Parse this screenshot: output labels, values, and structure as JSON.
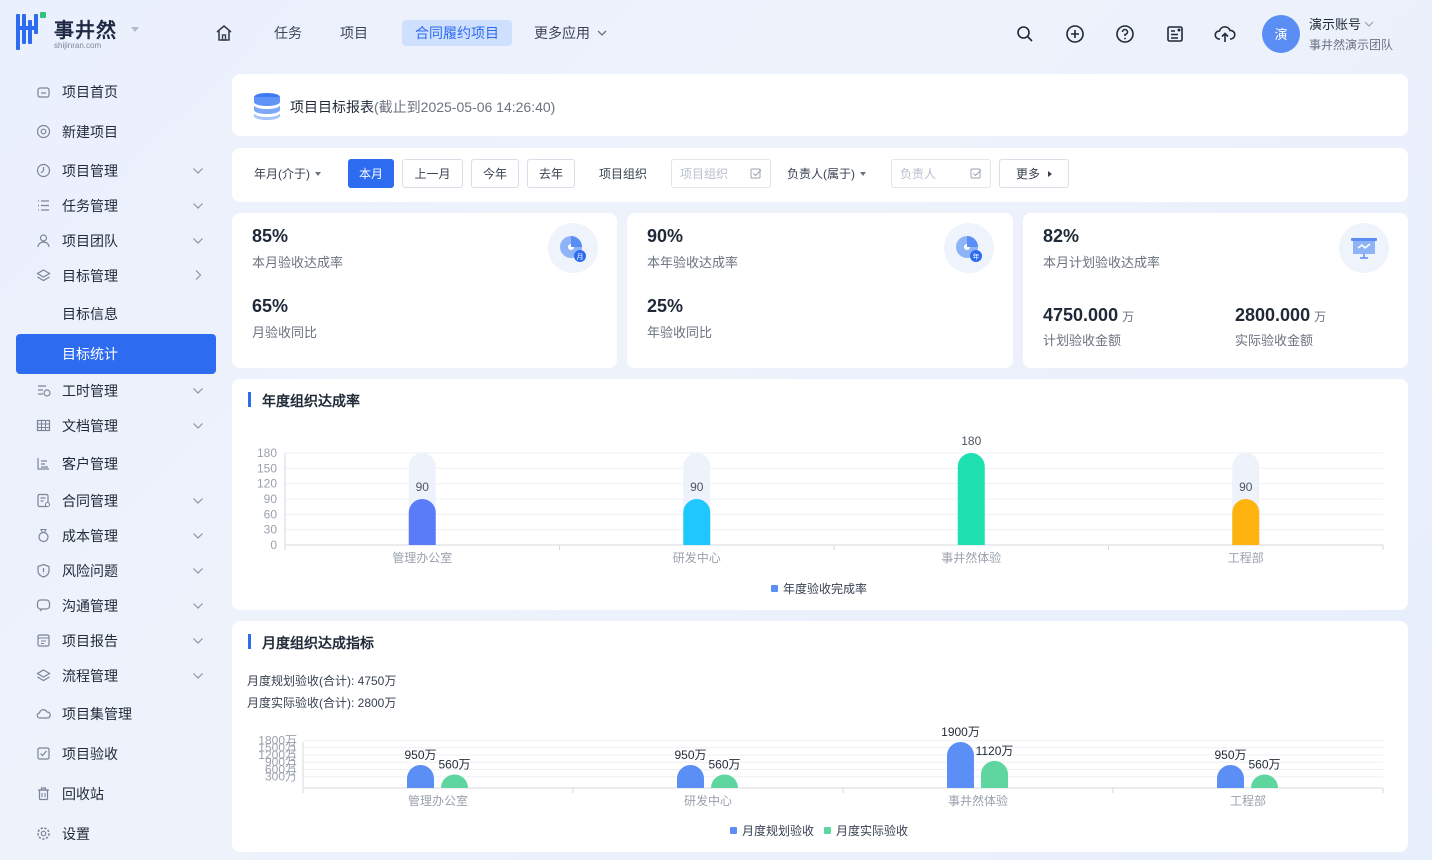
{
  "app": {
    "logo_title": "事井然",
    "logo_sub": "shijinran.com"
  },
  "nav": {
    "items": [
      "任务",
      "项目",
      "合同履约项目",
      "更多应用"
    ],
    "active_index": 2
  },
  "user": {
    "name": "演示账号",
    "team": "事井然演示团队",
    "avatar_text": "演"
  },
  "sidebar": {
    "items": [
      {
        "label": "项目首页",
        "icon": "home-icon",
        "chevron": ""
      },
      {
        "label": "新建项目",
        "icon": "at-icon",
        "chevron": ""
      },
      {
        "label": "项目管理",
        "icon": "clock-icon",
        "chevron": "down"
      },
      {
        "label": "任务管理",
        "icon": "list-icon",
        "chevron": "down"
      },
      {
        "label": "项目团队",
        "icon": "user-icon",
        "chevron": "down"
      },
      {
        "label": "目标管理",
        "icon": "layers-icon",
        "chevron": "right"
      },
      {
        "label": "目标信息",
        "icon": "",
        "chevron": ""
      },
      {
        "label": "目标统计",
        "icon": "",
        "chevron": ""
      },
      {
        "label": "工时管理",
        "icon": "timesheet-icon",
        "chevron": "down"
      },
      {
        "label": "文档管理",
        "icon": "table-icon",
        "chevron": "down"
      },
      {
        "label": "客户管理",
        "icon": "customer-icon",
        "chevron": ""
      },
      {
        "label": "合同管理",
        "icon": "contract-icon",
        "chevron": "down"
      },
      {
        "label": "成本管理",
        "icon": "cost-icon",
        "chevron": "down"
      },
      {
        "label": "风险问题",
        "icon": "shield-icon",
        "chevron": "down"
      },
      {
        "label": "沟通管理",
        "icon": "chat-icon",
        "chevron": "down"
      },
      {
        "label": "项目报告",
        "icon": "report-icon",
        "chevron": "down"
      },
      {
        "label": "流程管理",
        "icon": "layers-icon",
        "chevron": "down"
      },
      {
        "label": "项目集管理",
        "icon": "cloud-icon",
        "chevron": ""
      },
      {
        "label": "项目验收",
        "icon": "check-icon",
        "chevron": ""
      },
      {
        "label": "回收站",
        "icon": "trash-icon",
        "chevron": ""
      },
      {
        "label": "设置",
        "icon": "gear-icon",
        "chevron": ""
      }
    ],
    "active_index": 7
  },
  "report": {
    "title": "项目目标报表",
    "subtitle": "(截止到2025-05-06 14:26:40)"
  },
  "filters": {
    "period_label": "年月(介于)",
    "buttons": [
      "本月",
      "上一月",
      "今年",
      "去年"
    ],
    "active_button": 0,
    "org_label": "项目组织",
    "org_placeholder": "项目组织",
    "owner_label": "负责人(属于)",
    "owner_placeholder": "负责人",
    "more_label": "更多"
  },
  "stats": {
    "card1": {
      "value1": "85%",
      "label1": "本月验收达成率",
      "value2": "65%",
      "label2": "月验收同比",
      "badge": "月"
    },
    "card2": {
      "value1": "90%",
      "label1": "本年验收达成率",
      "value2": "25%",
      "label2": "年验收同比",
      "badge": "年"
    },
    "card3": {
      "value1": "82%",
      "label1": "本月计划验收达成率",
      "amount1": "4750.000",
      "amount1_label": "计划验收金额",
      "amount2": "2800.000",
      "amount2_label": "实际验收金额",
      "unit": "万"
    }
  },
  "chart_data": [
    {
      "type": "bar",
      "title": "年度组织达成率",
      "categories": [
        "管理办公室",
        "研发中心",
        "事井然体验",
        "工程部"
      ],
      "series": [
        {
          "name": "年度验收完成率",
          "values": [
            90,
            90,
            180,
            90
          ]
        }
      ],
      "yticks": [
        "0",
        "30",
        "60",
        "90",
        "120",
        "150",
        "180"
      ],
      "ylim": [
        0,
        180
      ],
      "colors": [
        "#5a7cf9",
        "#1ec8ff",
        "#1fe0b0",
        "#ffb30f"
      ]
    },
    {
      "type": "bar",
      "title": "月度组织达成指标",
      "subtitle1": "月度规划验收(合计): 4750万",
      "subtitle2": "月度实际验收(合计): 2800万",
      "categories": [
        "管理办公室",
        "研发中心",
        "事井然体验",
        "工程部"
      ],
      "series": [
        {
          "name": "月度规划验收",
          "values": [
            950,
            950,
            1900,
            950
          ],
          "labels": [
            "950万",
            "950万",
            "1900万",
            "950万"
          ],
          "color": "#5b8ff5"
        },
        {
          "name": "月度实际验收",
          "values": [
            560,
            560,
            1120,
            560
          ],
          "labels": [
            "560万",
            "560万",
            "1120万",
            "560万"
          ],
          "color": "#5fd6a0"
        }
      ],
      "yticks": [
        "300万",
        "600万",
        "900万",
        "1200万",
        "1500万",
        "1800万"
      ],
      "ylim": [
        0,
        1900
      ]
    }
  ]
}
